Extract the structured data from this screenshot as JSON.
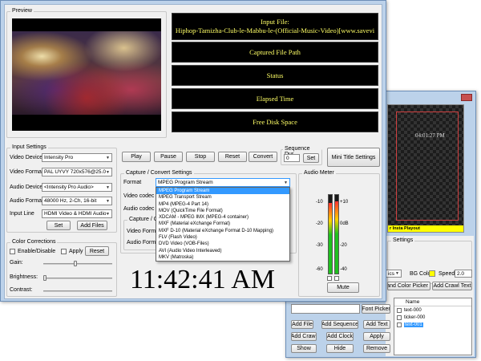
{
  "preview": {
    "label": "Preview"
  },
  "info": {
    "input_file_label": "Input File:",
    "input_file_name": "Hiphop-Tamizha-Club-le-Mabbu-le-(Official-Music-Video)[www.savevi",
    "captured_path": "Captured File Path",
    "status": "Status",
    "elapsed": "Elapsed Time",
    "disk": "Free Disk Space"
  },
  "input_settings": {
    "label": "Input Settings",
    "video_device_label": "Video Device",
    "video_device": "Intensity Pro",
    "video_format_label": "Video Format",
    "video_format": "PAL UYVY 720x576@25.0",
    "audio_device_label": "Audio Device",
    "audio_device": "<Intensity Pro Audio>",
    "audio_format_label": "Audio Format",
    "audio_format": "48000 Hz, 2-Ch, 16-bit",
    "input_line_label": "Input Line",
    "input_line": "HDMI Video & HDMI Audio",
    "set": "Set",
    "add_files": "Add Files"
  },
  "color": {
    "label": "Color Corrections",
    "enable": "Enable/Disable",
    "apply": "Apply",
    "reset": "Reset",
    "gain": "Gain:",
    "brightness": "Brightness:",
    "contrast": "Contrast:"
  },
  "transport": {
    "play": "Play",
    "pause": "Pause",
    "stop": "Stop",
    "reset": "Reset",
    "convert": "Convert",
    "seq_label": "Sequence Dur",
    "seq_value": "0",
    "set": "Set",
    "mini_title": "Mini Title Settings"
  },
  "capture": {
    "label": "Capture / Convert Settings",
    "format_label": "Format",
    "format_value": "MPEG Program Stream",
    "video_codec_label": "Video codec",
    "audio_codec_label": "Audio codec",
    "sub_label": "Capture / Con",
    "video_format_label": "Video Format",
    "audio_format_label": "Audio Format",
    "options": [
      "MPEG Program Stream",
      "MPEG Transport Stream",
      "MP4 (MPEG-4 Part 14)",
      "MOV (QuickTime File Format)",
      "XDCAM - MPEG IMX (MPEG-4 container)",
      "MXF (Material eXchange Format)",
      "MXF D-10 (Material eXchange Format D-10 Mapping)",
      "FLV (Flash Video)",
      "DVD Video (VOB-Files)",
      "AVI (Audio Video Interleaved)",
      "MKV (Matroska)"
    ]
  },
  "audio_meter": {
    "label": "Audio Meter",
    "ticks_left": [
      "-10",
      "-20",
      "-30",
      "-60"
    ],
    "ticks_right": [
      "+10",
      "0dB",
      "-20",
      "-40"
    ],
    "level_left": 0.9,
    "level_right": 0.92,
    "mute": "Mute"
  },
  "clock": "11:42:41 AM",
  "playout": {
    "time": "04:01:27 PM",
    "ticker": "r Insta Playout",
    "settings_label": "Settings",
    "partial_combo": "ics",
    "bg_color_label": "BG Color",
    "speed_label": "Speed",
    "speed_value": "2.0",
    "font_color_picker": "and Color Picker",
    "add_crawl_text": "Add Crawl Text",
    "font_picker": "Font Picker",
    "add_file": "Add File",
    "add_sequence": "Add Sequence",
    "add_text": "Add Text",
    "add_crawl": "Add Crawl",
    "add_clock": "Add Clock",
    "apply": "Apply",
    "show": "Show",
    "hide": "Hide",
    "remove": "Remove",
    "list_header": "Name",
    "items": [
      "text-000",
      "ticker-000",
      "text-001"
    ]
  },
  "colors": {
    "accent": "#3399ff",
    "info_text": "#ffff66",
    "ticker_bg": "#ffff00",
    "bg_swatch": "#ffff00"
  }
}
